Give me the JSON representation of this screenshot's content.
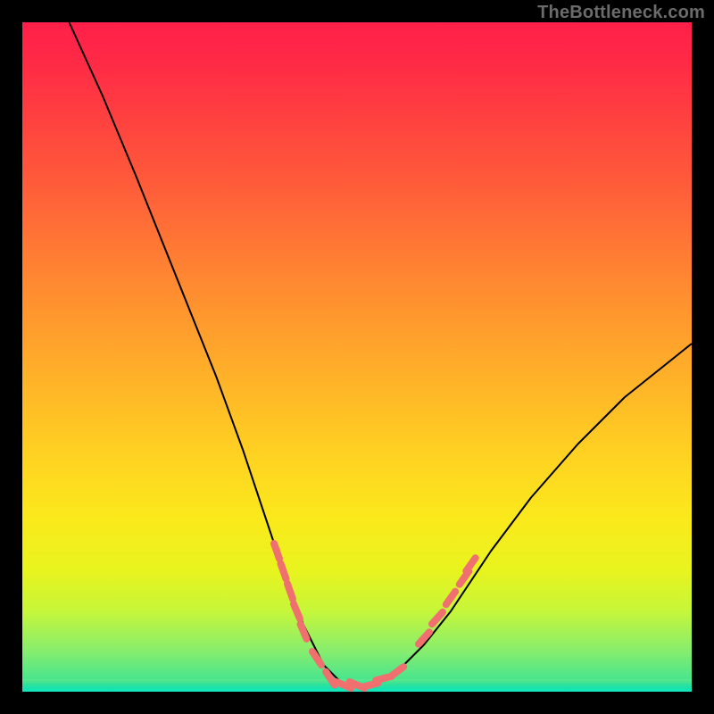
{
  "watermark": "TheBottleneck.com",
  "colors": {
    "background": "#000000",
    "curve": "#000000",
    "marker": "#f07070",
    "plot_gradient": [
      "#ff1f4a",
      "#ff4040",
      "#ff7a34",
      "#ffb428",
      "#fbe91c",
      "#c6f63a",
      "#2de19c"
    ]
  },
  "chart_data": {
    "type": "line",
    "title": "",
    "xlabel": "",
    "ylabel": "",
    "xlim": [
      0,
      100
    ],
    "ylim": [
      0,
      100
    ],
    "note": "Approximate V-shaped bottleneck curve. y = bottleneck %, minimum near x≈48. Markers indicate sampled data points near the curve bottom and lower slopes.",
    "curve_points": [
      {
        "x": 7,
        "y": 100
      },
      {
        "x": 12,
        "y": 89
      },
      {
        "x": 17,
        "y": 77
      },
      {
        "x": 21,
        "y": 67
      },
      {
        "x": 25,
        "y": 57
      },
      {
        "x": 29,
        "y": 47
      },
      {
        "x": 33,
        "y": 36
      },
      {
        "x": 36,
        "y": 27
      },
      {
        "x": 39,
        "y": 18
      },
      {
        "x": 42,
        "y": 10
      },
      {
        "x": 45,
        "y": 4
      },
      {
        "x": 48,
        "y": 1
      },
      {
        "x": 52,
        "y": 1
      },
      {
        "x": 56,
        "y": 3
      },
      {
        "x": 60,
        "y": 7
      },
      {
        "x": 64,
        "y": 12
      },
      {
        "x": 70,
        "y": 21
      },
      {
        "x": 76,
        "y": 29
      },
      {
        "x": 83,
        "y": 37
      },
      {
        "x": 90,
        "y": 44
      },
      {
        "x": 100,
        "y": 52
      }
    ],
    "markers": [
      {
        "x": 38,
        "y": 21
      },
      {
        "x": 39,
        "y": 18
      },
      {
        "x": 40,
        "y": 15
      },
      {
        "x": 41,
        "y": 12
      },
      {
        "x": 42,
        "y": 9
      },
      {
        "x": 44,
        "y": 5
      },
      {
        "x": 46,
        "y": 2
      },
      {
        "x": 48,
        "y": 1
      },
      {
        "x": 50,
        "y": 1
      },
      {
        "x": 52,
        "y": 1
      },
      {
        "x": 54,
        "y": 2
      },
      {
        "x": 56,
        "y": 3
      },
      {
        "x": 60,
        "y": 8
      },
      {
        "x": 62,
        "y": 11
      },
      {
        "x": 64,
        "y": 14
      },
      {
        "x": 66,
        "y": 17
      },
      {
        "x": 67,
        "y": 19
      }
    ]
  }
}
